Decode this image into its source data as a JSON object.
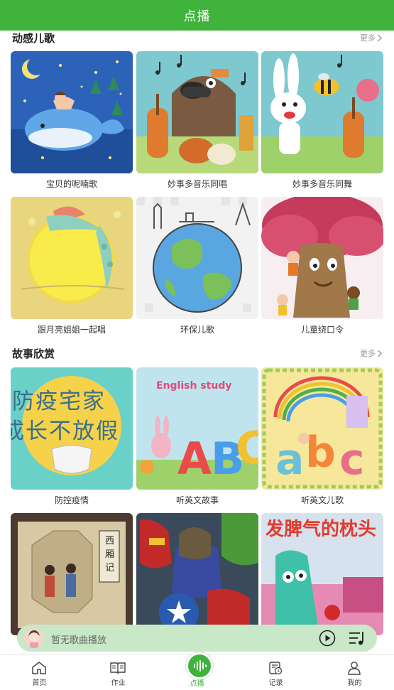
{
  "header": {
    "title": "点播"
  },
  "sections": [
    {
      "title": "动感儿歌",
      "more": "更多",
      "items": [
        {
          "label": "宝贝的呢喃歌"
        },
        {
          "label": "妙事多音乐同唱"
        },
        {
          "label": "妙事多音乐同舞"
        },
        {
          "label": "跟月亮姐姐一起唱"
        },
        {
          "label": "环保儿歌"
        },
        {
          "label": "儿童绕口令"
        }
      ]
    },
    {
      "title": "故事欣赏",
      "more": "更多",
      "items": [
        {
          "label": "防控疫情",
          "art_text": "防疫宅家",
          "art_text2": "成长不放假"
        },
        {
          "label": "听英文故事",
          "art_text": "English study"
        },
        {
          "label": "听英文儿歌"
        },
        {
          "label": "",
          "art_text": "西厢记"
        },
        {
          "label": ""
        },
        {
          "label": "",
          "art_text": "发脾气的枕头"
        }
      ]
    }
  ],
  "player": {
    "status": "暂无歌曲播放"
  },
  "tabs": [
    {
      "label": "首页",
      "icon": "home-icon"
    },
    {
      "label": "作业",
      "icon": "book-icon"
    },
    {
      "label": "点播",
      "icon": "audio-wave-icon",
      "active": true
    },
    {
      "label": "记录",
      "icon": "record-icon"
    },
    {
      "label": "我的",
      "icon": "user-icon"
    }
  ],
  "colors": {
    "brand": "#3fb33b",
    "player_bg": "#c9e8c7"
  }
}
